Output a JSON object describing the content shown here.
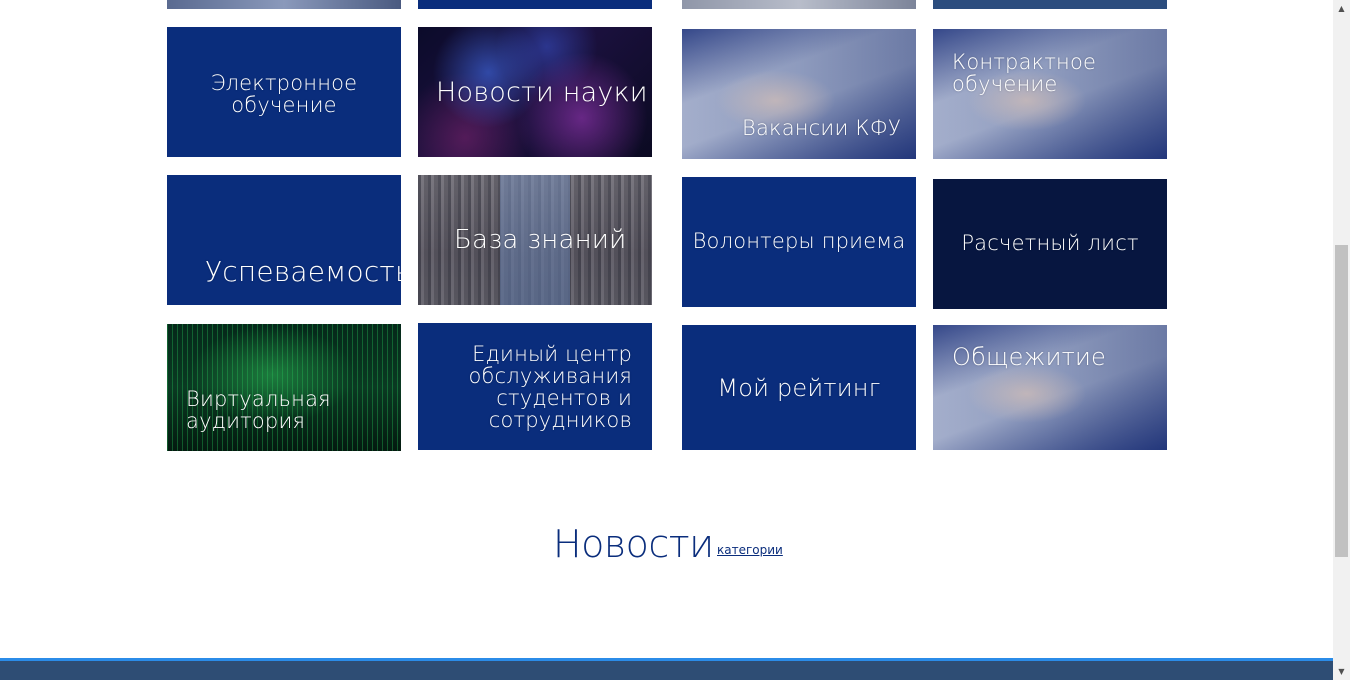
{
  "tiles": [
    {
      "label": "Электронное\nобучение"
    },
    {
      "label": "Новости науки"
    },
    {
      "label": "Вакансии КФУ"
    },
    {
      "label": "Контрактное\nобучение"
    },
    {
      "label": "Успеваемость"
    },
    {
      "label": "База знаний"
    },
    {
      "label": "Волонтеры приема"
    },
    {
      "label": "Расчетный лист"
    },
    {
      "label": "Виртуальная\nаудитория"
    },
    {
      "label": "Единый центр\nобслуживания\nстудентов и\nсотрудников"
    },
    {
      "label": "Мой рейтинг"
    },
    {
      "label": "Общежитие"
    }
  ],
  "news_section": {
    "title": "Новости",
    "categories_link": "категории"
  },
  "colors": {
    "navy": "#0a2d7c",
    "dark_navy": "#071640",
    "footer": "#2e4d74",
    "footer_accent": "#2b8ce8"
  },
  "icons": {
    "scroll_up": "▲",
    "scroll_down": "▼"
  }
}
